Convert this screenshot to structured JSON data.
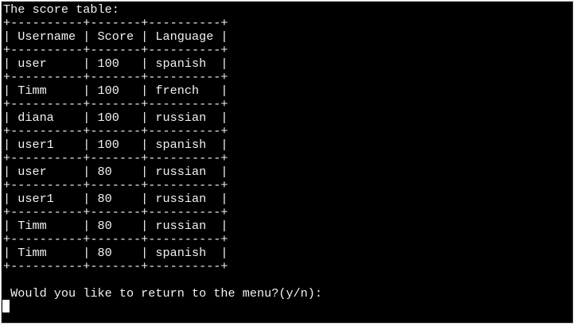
{
  "terminal": {
    "heading": "The score table:",
    "border_line": "+----------+-------+----------+",
    "header_row": "| Username | Score | Language |",
    "rows": [
      "| user     | 100   | spanish  |",
      "| Timm     | 100   | french   |",
      "| diana    | 100   | russian  |",
      "| user1    | 100   | spanish  |",
      "| user     | 80    | russian  |",
      "| user1    | 80    | russian  |",
      "| Timm     | 80    | russian  |",
      "| Timm     | 80    | spanish  |"
    ],
    "prompt": " Would you like to return to the menu?(y/n):"
  }
}
